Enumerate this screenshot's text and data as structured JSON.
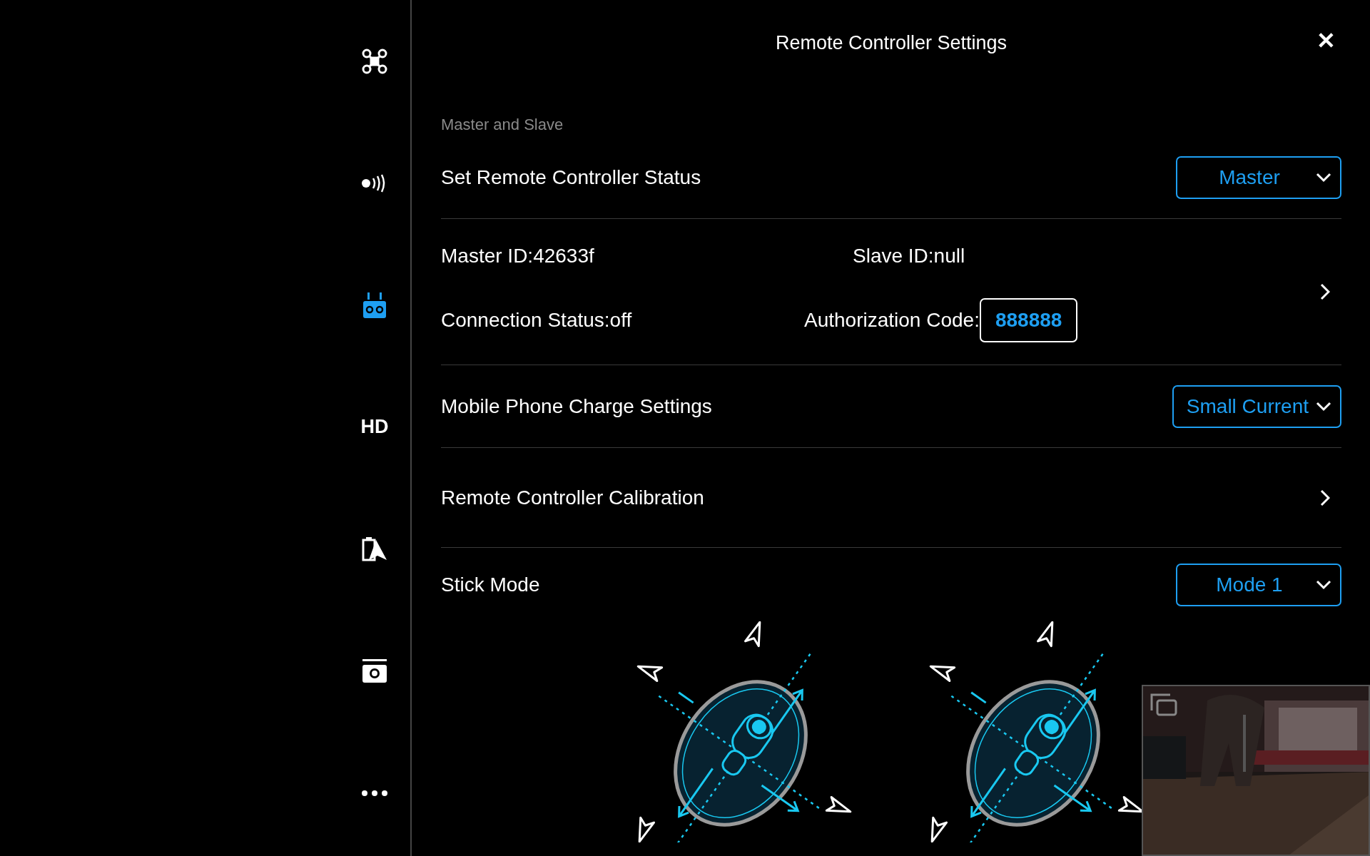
{
  "sidebar": {
    "items": [
      {
        "kind": "icon",
        "selected": false
      },
      {
        "kind": "icon",
        "selected": false
      },
      {
        "kind": "icon",
        "selected": true
      },
      {
        "kind": "text",
        "label": "HD",
        "selected": false
      },
      {
        "kind": "icon",
        "selected": false
      },
      {
        "kind": "icon",
        "selected": false
      },
      {
        "kind": "icon",
        "selected": false
      }
    ]
  },
  "header": {
    "title": "Remote Controller Settings",
    "close": "✕"
  },
  "section": "Master and Slave",
  "rows": [
    {
      "kind": "dropdown",
      "label": "Set Remote Controller Status",
      "value": "Master"
    },
    {
      "kind": "info",
      "master_id": "Master ID:42633f",
      "slave_id": "Slave ID:null",
      "connection": "Connection Status:off",
      "auth_label": "Authorization Code:",
      "auth_code": "888888"
    },
    {
      "kind": "dropdown",
      "label": "Mobile Phone Charge Settings",
      "value": "Small Current"
    },
    {
      "kind": "link",
      "label": "Remote Controller Calibration"
    },
    {
      "kind": "dropdown",
      "label": "Stick Mode",
      "value": "Mode 1"
    }
  ]
}
